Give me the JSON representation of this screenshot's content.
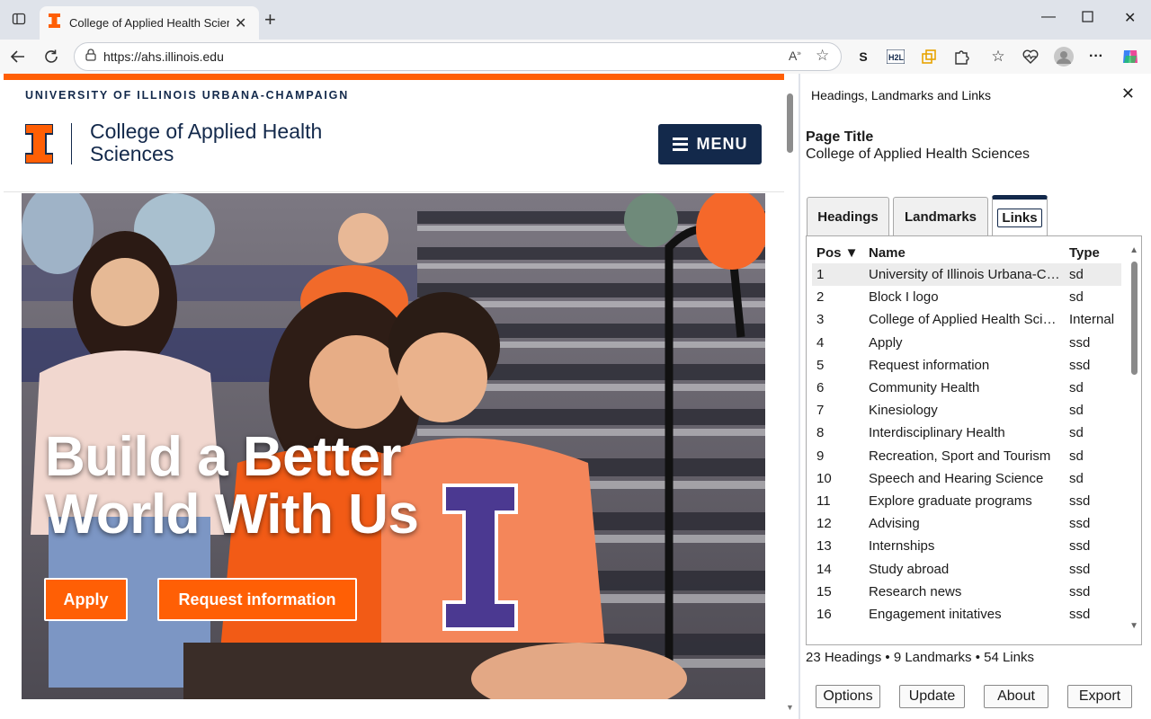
{
  "browser": {
    "tab_title": "College of Applied Health Sciences",
    "url": "https://ahs.illinois.edu"
  },
  "site": {
    "university": "UNIVERSITY OF ILLINOIS URBANA-CHAMPAIGN",
    "college_line1": "College of Applied Health",
    "college_line2": "Sciences",
    "menu_label": "MENU",
    "hero_line1": "Build a Better",
    "hero_line2": "World With Us",
    "apply_label": "Apply",
    "request_label": "Request information",
    "colors": {
      "orange": "#ff5f05",
      "navy": "#13294b"
    }
  },
  "panel": {
    "title": "Headings, Landmarks and Links",
    "page_title_label": "Page Title",
    "page_title_value": "College of Applied Health Sciences",
    "tabs": [
      {
        "label": "Headings"
      },
      {
        "label": "Landmarks"
      },
      {
        "label": "Links"
      }
    ],
    "columns": {
      "pos": "Pos ▼",
      "name": "Name",
      "type": "Type"
    },
    "rows": [
      {
        "pos": "1",
        "name": "University of Illinois Urbana-Champaign",
        "type": "sd"
      },
      {
        "pos": "2",
        "name": "Block I logo",
        "type": "sd"
      },
      {
        "pos": "3",
        "name": "College of Applied Health Sciences",
        "type": "Internal"
      },
      {
        "pos": "4",
        "name": "Apply",
        "type": "ssd"
      },
      {
        "pos": "5",
        "name": "Request information",
        "type": "ssd"
      },
      {
        "pos": "6",
        "name": "Community Health",
        "type": "sd"
      },
      {
        "pos": "7",
        "name": "Kinesiology",
        "type": "sd"
      },
      {
        "pos": "8",
        "name": "Interdisciplinary Health",
        "type": "sd"
      },
      {
        "pos": "9",
        "name": "Recreation, Sport and Tourism",
        "type": "sd"
      },
      {
        "pos": "10",
        "name": "Speech and Hearing Science",
        "type": "sd"
      },
      {
        "pos": "11",
        "name": "Explore graduate programs",
        "type": "ssd"
      },
      {
        "pos": "12",
        "name": "Advising",
        "type": "ssd"
      },
      {
        "pos": "13",
        "name": "Internships",
        "type": "ssd"
      },
      {
        "pos": "14",
        "name": "Study abroad",
        "type": "ssd"
      },
      {
        "pos": "15",
        "name": "Research news",
        "type": "ssd"
      },
      {
        "pos": "16",
        "name": "Engagement initatives",
        "type": "ssd"
      }
    ],
    "summary": "23 Headings • 9 Landmarks • 54 Links",
    "buttons": {
      "options": "Options",
      "update": "Update",
      "about": "About",
      "export": "Export"
    }
  }
}
